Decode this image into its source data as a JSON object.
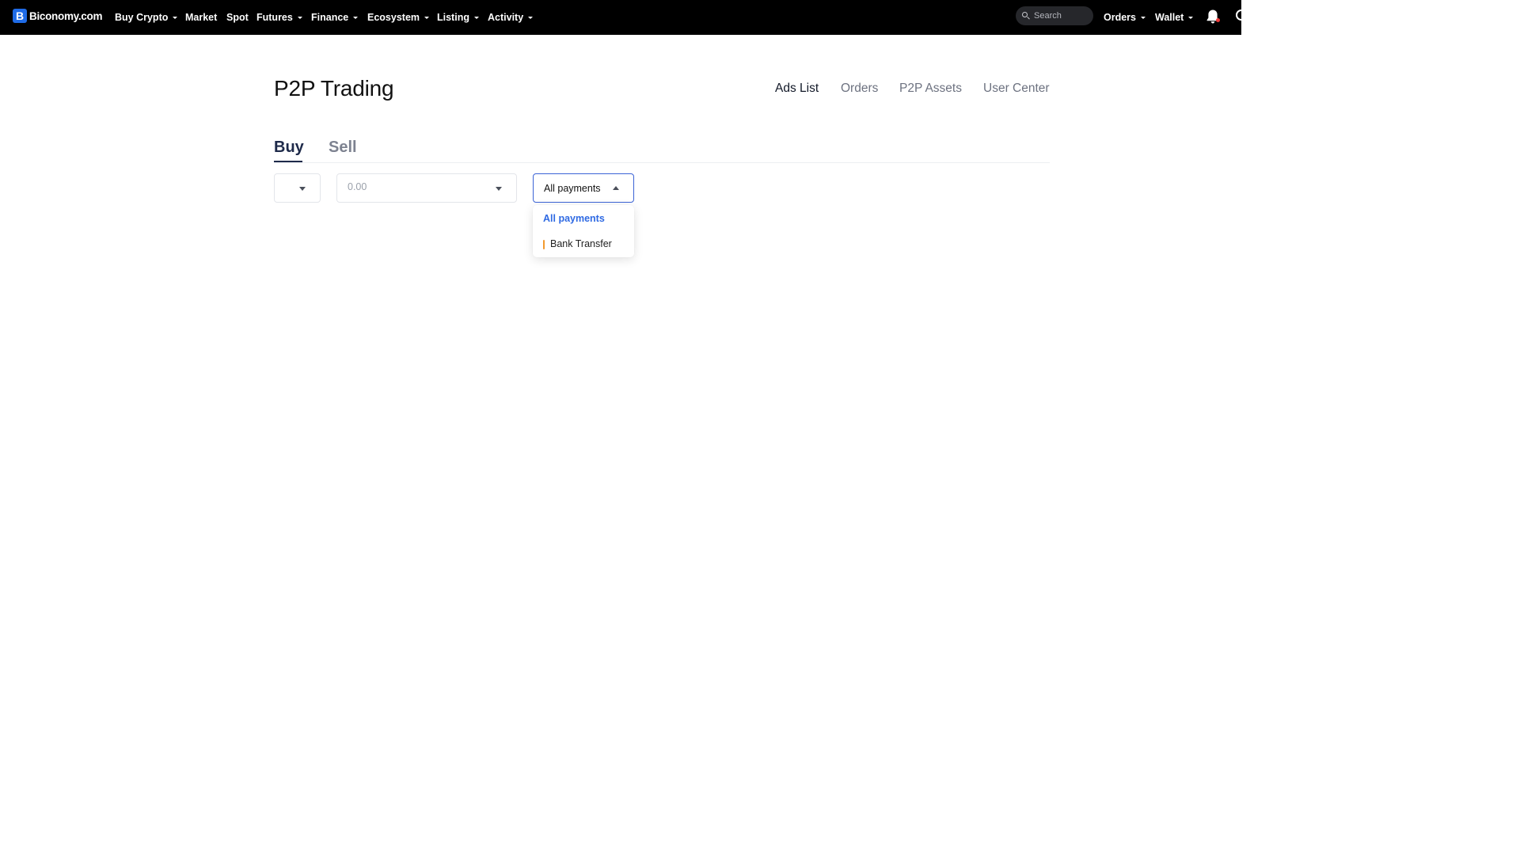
{
  "brand": {
    "badge": "B",
    "name": "Biconomy.com",
    "color": "#1f6be6"
  },
  "topnav": {
    "items": [
      {
        "label": "Buy Crypto",
        "has_dropdown": true
      },
      {
        "label": "Market",
        "has_dropdown": false
      },
      {
        "label": "Spot",
        "has_dropdown": false
      },
      {
        "label": "Futures",
        "has_dropdown": true
      },
      {
        "label": "Finance",
        "has_dropdown": true
      },
      {
        "label": "Ecosystem",
        "has_dropdown": true
      },
      {
        "label": "Listing",
        "has_dropdown": true
      },
      {
        "label": "Activity",
        "has_dropdown": true
      }
    ],
    "search_placeholder": "Search",
    "right": {
      "orders_label": "Orders",
      "wallet_label": "Wallet"
    },
    "icons": [
      "search-icon",
      "bell-icon",
      "avatar-icon"
    ]
  },
  "page": {
    "title": "P2P Trading",
    "subnav": [
      {
        "label": "Ads List",
        "active": true
      },
      {
        "label": "Orders",
        "active": false
      },
      {
        "label": "P2P Assets",
        "active": false
      },
      {
        "label": "User Center",
        "active": false
      }
    ],
    "tabs": [
      {
        "label": "Buy",
        "active": true
      },
      {
        "label": "Sell",
        "active": false
      }
    ]
  },
  "filters": {
    "crypto_select_value": "",
    "amount_placeholder": "0.00",
    "payment": {
      "selected": "All payments",
      "expanded": true,
      "options": [
        {
          "label": "All payments",
          "selected": true
        },
        {
          "label": "Bank Transfer",
          "selected": false,
          "marker_color": "#f29a2e"
        }
      ]
    }
  },
  "colors": {
    "nav_bg": "#000000",
    "accent_blue": "#2f6ae3",
    "active_tab": "#1e2a4a"
  }
}
